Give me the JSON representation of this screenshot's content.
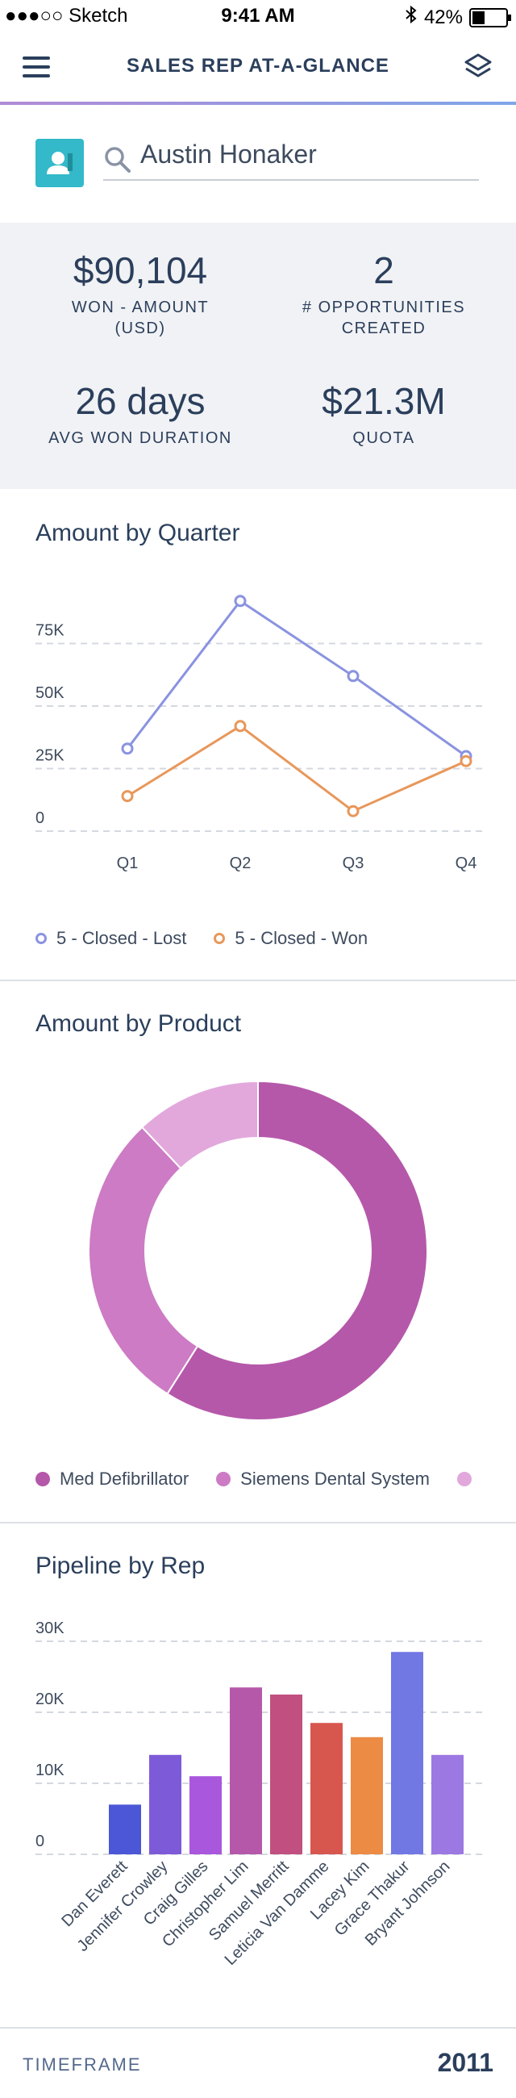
{
  "status_bar": {
    "carrier": "●●●○○ Sketch",
    "time": "9:41 AM",
    "battery": "42%",
    "battery_level": 0.42
  },
  "nav": {
    "title": "SALES REP AT-A-GLANCE"
  },
  "search": {
    "value": "Austin Honaker"
  },
  "kpis": [
    {
      "value": "$90,104",
      "label": "WON - AMOUNT (USD)"
    },
    {
      "value": "2",
      "label": "# OPPORTUNITIES CREATED"
    },
    {
      "value": "26 days",
      "label": "AVG WON DURATION"
    },
    {
      "value": "$21.3M",
      "label": "QUOTA"
    }
  ],
  "cards": {
    "quarter_title": "Amount by Quarter",
    "product_title": "Amount by Product",
    "pipeline_title": "Pipeline by Rep"
  },
  "legends": {
    "quarter": [
      "5 - Closed - Lost",
      "5 - Closed - Won"
    ],
    "product": [
      "Med Defibrillator",
      "Siemens Dental System"
    ]
  },
  "footer": {
    "label": "TIMEFRAME",
    "value": "2011"
  },
  "colors": {
    "accent": "#33b9c9",
    "lost": "#8a93e0",
    "won": "#e8975a"
  },
  "chart_data": [
    {
      "type": "line",
      "title": "Amount by Quarter",
      "categories": [
        "Q1",
        "Q2",
        "Q3",
        "Q4"
      ],
      "yticks": [
        "0",
        "25K",
        "50K",
        "75K"
      ],
      "ylim": [
        0,
        100000
      ],
      "series": [
        {
          "name": "5 - Closed - Lost",
          "color": "#8a93e0",
          "values": [
            33000,
            92000,
            62000,
            30000
          ]
        },
        {
          "name": "5 - Closed - Won",
          "color": "#e8975a",
          "values": [
            14000,
            42000,
            8000,
            28000
          ]
        }
      ],
      "grid": true,
      "legend": "bottom"
    },
    {
      "type": "pie",
      "title": "Amount by Product",
      "donut": true,
      "slices": [
        {
          "name": "Med Defibrillator",
          "value": 59,
          "color": "#b558aa"
        },
        {
          "name": "Siemens Dental System",
          "value": 29,
          "color": "#cc7bc4"
        },
        {
          "name": "",
          "value": 12,
          "color": "#e2a8dc"
        }
      ],
      "legend": "bottom"
    },
    {
      "type": "bar",
      "title": "Pipeline by Rep",
      "categories": [
        "Dan Everett",
        "Jennifer Crowley",
        "Craig Gilles",
        "Christopher Lim",
        "Samuel Merritt",
        "Leticia Van Damme",
        "Lacey Kim",
        "Grace Thakur",
        "Bryant Johnson"
      ],
      "values": [
        7000,
        14000,
        11000,
        23500,
        22500,
        18500,
        16500,
        28500,
        14000
      ],
      "colors": [
        "#4b57d6",
        "#7d5bd8",
        "#a957dd",
        "#b558aa",
        "#c14f7f",
        "#d7574f",
        "#ec8b44",
        "#7178e4",
        "#9b78e2"
      ],
      "yticks": [
        "0",
        "10K",
        "20K",
        "30K"
      ],
      "ylim": [
        0,
        30000
      ],
      "grid": true
    }
  ]
}
